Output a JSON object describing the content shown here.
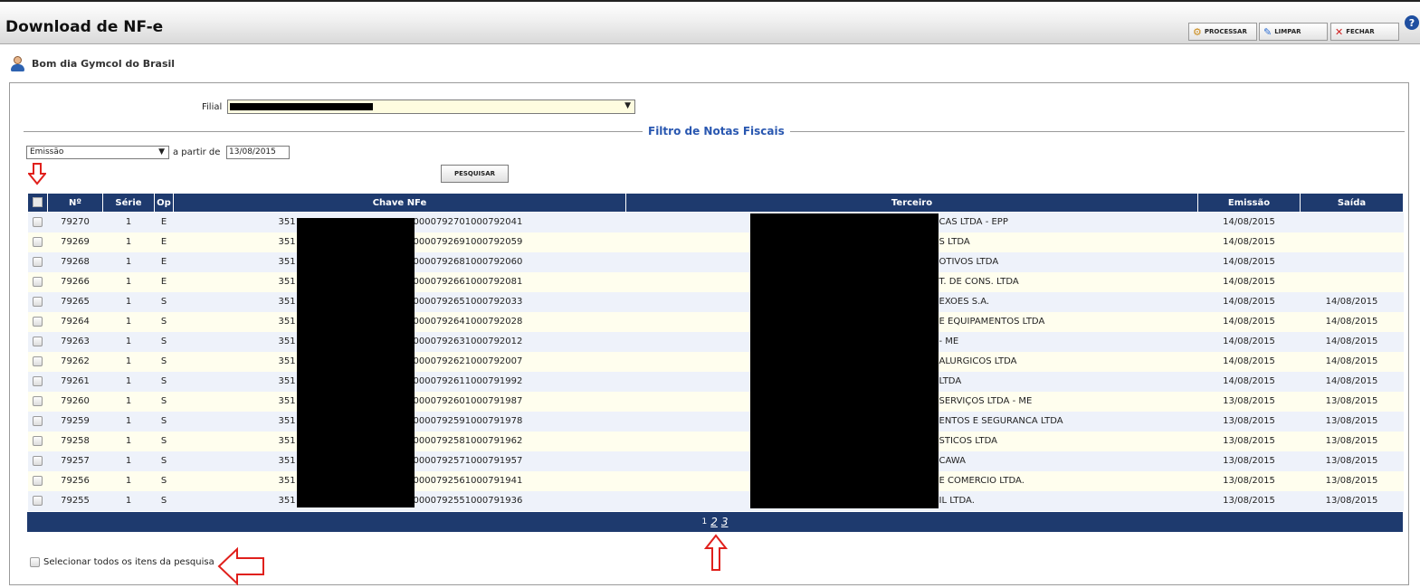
{
  "header": {
    "title": "Download de NF-e",
    "buttons": [
      {
        "label": "PROCESSAR",
        "icon": "gears-icon"
      },
      {
        "label": "LIMPAR",
        "icon": "eraser-icon"
      },
      {
        "label": "FECHAR",
        "icon": "close-icon"
      }
    ],
    "help": "?"
  },
  "greeting": "Bom dia Gymcol do Brasil",
  "filial": {
    "label": "Filial",
    "value": "",
    "arrow": "▼"
  },
  "filter": {
    "legend": "Filtro de Notas Fiscais",
    "date_type": "Emissão",
    "arrow": "▼",
    "from_label": "a partir de",
    "date": "13/08/2015",
    "search_button": "PESQUISAR"
  },
  "table": {
    "columns": [
      "Nº",
      "Série",
      "Op",
      "Chave NFe",
      "Terceiro",
      "Emissão",
      "Saída"
    ],
    "rows": [
      {
        "num": "79270",
        "serie": "1",
        "op": "E",
        "chave_pre": "351",
        "chave_suf": "0000792701000792041",
        "terceiro": "CAS LTDA - EPP",
        "emissao": "14/08/2015",
        "saida": ""
      },
      {
        "num": "79269",
        "serie": "1",
        "op": "E",
        "chave_pre": "351",
        "chave_suf": "0000792691000792059",
        "terceiro": "S LTDA",
        "emissao": "14/08/2015",
        "saida": ""
      },
      {
        "num": "79268",
        "serie": "1",
        "op": "E",
        "chave_pre": "351",
        "chave_suf": "0000792681000792060",
        "terceiro": "OTIVOS LTDA",
        "emissao": "14/08/2015",
        "saida": ""
      },
      {
        "num": "79266",
        "serie": "1",
        "op": "E",
        "chave_pre": "351",
        "chave_suf": "0000792661000792081",
        "terceiro": "T. DE CONS. LTDA",
        "emissao": "14/08/2015",
        "saida": ""
      },
      {
        "num": "79265",
        "serie": "1",
        "op": "S",
        "chave_pre": "351",
        "chave_suf": "0000792651000792033",
        "terceiro": "EXOES S.A.",
        "emissao": "14/08/2015",
        "saida": "14/08/2015"
      },
      {
        "num": "79264",
        "serie": "1",
        "op": "S",
        "chave_pre": "351",
        "chave_suf": "0000792641000792028",
        "terceiro": "E EQUIPAMENTOS LTDA",
        "emissao": "14/08/2015",
        "saida": "14/08/2015"
      },
      {
        "num": "79263",
        "serie": "1",
        "op": "S",
        "chave_pre": "351",
        "chave_suf": "0000792631000792012",
        "terceiro": "- ME",
        "emissao": "14/08/2015",
        "saida": "14/08/2015"
      },
      {
        "num": "79262",
        "serie": "1",
        "op": "S",
        "chave_pre": "351",
        "chave_suf": "0000792621000792007",
        "terceiro": "ALURGICOS LTDA",
        "emissao": "14/08/2015",
        "saida": "14/08/2015"
      },
      {
        "num": "79261",
        "serie": "1",
        "op": "S",
        "chave_pre": "351",
        "chave_suf": "0000792611000791992",
        "terceiro": "LTDA",
        "emissao": "14/08/2015",
        "saida": "14/08/2015"
      },
      {
        "num": "79260",
        "serie": "1",
        "op": "S",
        "chave_pre": "351",
        "chave_suf": "0000792601000791987",
        "terceiro": "SERVIÇOS LTDA - ME",
        "emissao": "13/08/2015",
        "saida": "13/08/2015"
      },
      {
        "num": "79259",
        "serie": "1",
        "op": "S",
        "chave_pre": "351",
        "chave_suf": "0000792591000791978",
        "terceiro": "ENTOS E SEGURANCA LTDA",
        "emissao": "13/08/2015",
        "saida": "13/08/2015"
      },
      {
        "num": "79258",
        "serie": "1",
        "op": "S",
        "chave_pre": "351",
        "chave_suf": "0000792581000791962",
        "terceiro": "STICOS LTDA",
        "emissao": "13/08/2015",
        "saida": "13/08/2015"
      },
      {
        "num": "79257",
        "serie": "1",
        "op": "S",
        "chave_pre": "351",
        "chave_suf": "0000792571000791957",
        "terceiro": "CAWA",
        "emissao": "13/08/2015",
        "saida": "13/08/2015"
      },
      {
        "num": "79256",
        "serie": "1",
        "op": "S",
        "chave_pre": "351",
        "chave_suf": "0000792561000791941",
        "terceiro": "E COMERCIO LTDA.",
        "emissao": "13/08/2015",
        "saida": "13/08/2015"
      },
      {
        "num": "79255",
        "serie": "1",
        "op": "S",
        "chave_pre": "351",
        "chave_suf": "0000792551000791936",
        "terceiro": "IL LTDA.",
        "emissao": "13/08/2015",
        "saida": "13/08/2015"
      }
    ]
  },
  "pager": {
    "current": "1",
    "pages": [
      "2",
      "3"
    ]
  },
  "select_all_label": "Selecionar todos os itens da pesquisa",
  "colors": {
    "header_blue": "#1e3a6e",
    "legend_blue": "#2957b0",
    "row_odd": "#eef2fa",
    "row_even": "#fffeee",
    "annotation_red": "#e0201c"
  }
}
